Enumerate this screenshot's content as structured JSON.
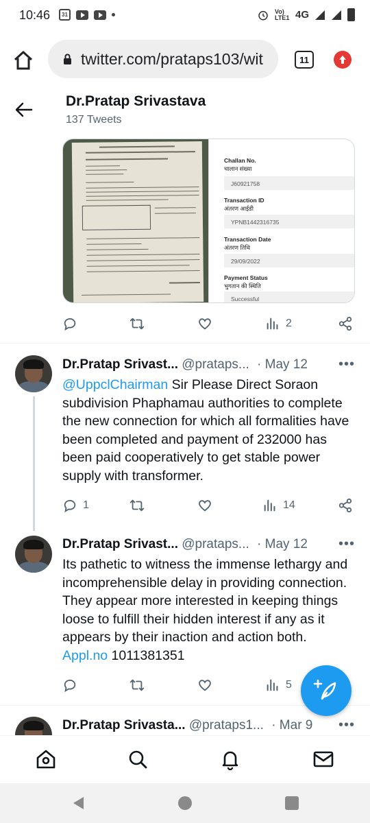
{
  "status_bar": {
    "time": "10:46",
    "calendar_day": "31",
    "network": "4G",
    "volte": "Vo) LTE1"
  },
  "browser": {
    "url": "twitter.com/prataps103/wit",
    "tab_count": "11"
  },
  "profile": {
    "name": "Dr.Pratap Srivastava",
    "tweet_count": "137 Tweets"
  },
  "media": {
    "receipt_fields": [
      {
        "label": "Challan No.",
        "label_hi": "चालान संख्या",
        "value": "J60921758"
      },
      {
        "label": "Transaction ID",
        "label_hi": "अंतरण आईडी",
        "value": "YPNB1442316735"
      },
      {
        "label": "Transaction Date",
        "label_hi": "अंतरण तिथि",
        "value": "29/09/2022"
      },
      {
        "label": "Payment Status",
        "label_hi": "भुगतान की स्थिति",
        "value": "Successful"
      }
    ]
  },
  "tweet0": {
    "actions": {
      "replies": "",
      "retweets": "",
      "likes": "",
      "views": "2"
    }
  },
  "tweet1": {
    "name": "Dr.Pratap Srivast...",
    "handle": "@prataps...",
    "date": "· May 12",
    "mention": "@UppclChairman",
    "text": " Sir Please Direct Soraon subdivision Phaphamau authorities to complete the new connection for which all formalities have been completed and payment of 232000 has been paid cooperatively to get stable power supply with transformer.",
    "actions": {
      "replies": "1",
      "retweets": "",
      "likes": "",
      "views": "14"
    }
  },
  "tweet2": {
    "name": "Dr.Pratap Srivast...",
    "handle": "@prataps...",
    "date": "· May 12",
    "text": "Its pathetic to witness the immense lethargy and incomprehensible delay in providing connection. They appear more interested in keeping things loose to fulfill their hidden interest if any as it appears by their inaction and action both. ",
    "link": "Appl.no",
    "text_tail": " 1011381351",
    "actions": {
      "replies": "",
      "retweets": "",
      "likes": "",
      "views": "5"
    }
  },
  "tweet3": {
    "name": "Dr.Pratap Srivasta...",
    "handle": "@prataps1...",
    "date": "· Mar 9"
  },
  "colors": {
    "accent": "#1d9bf0",
    "muted": "#536471",
    "update_red": "#e53935"
  }
}
